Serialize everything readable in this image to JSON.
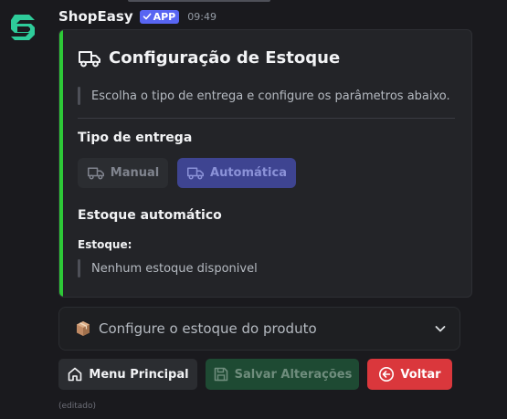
{
  "message": {
    "author": "ShopEasy",
    "badge": "APP",
    "timestamp": "09:49",
    "edited": "(editado)"
  },
  "embed": {
    "title": "Configuração de Estoque",
    "description": "Escolha o tipo de entrega e configure os parâmetros abaixo.",
    "delivery_section": "Tipo de entrega",
    "auto_section": "Estoque automático",
    "stock_field_name": "Estoque:",
    "stock_field_value": "Nenhum estoque disponivel"
  },
  "delivery_buttons": {
    "manual": "Manual",
    "automatic": "Automática"
  },
  "select_menu": {
    "placeholder": "Configure o estoque do produto"
  },
  "action_buttons": {
    "main_menu": "Menu Principal",
    "save": "Salvar Alterações",
    "back": "Voltar"
  },
  "colors": {
    "accent_bar": "#2dc937",
    "blurple": "#5865f2",
    "danger": "#da373c",
    "success_disabled": "#1e4a33"
  }
}
